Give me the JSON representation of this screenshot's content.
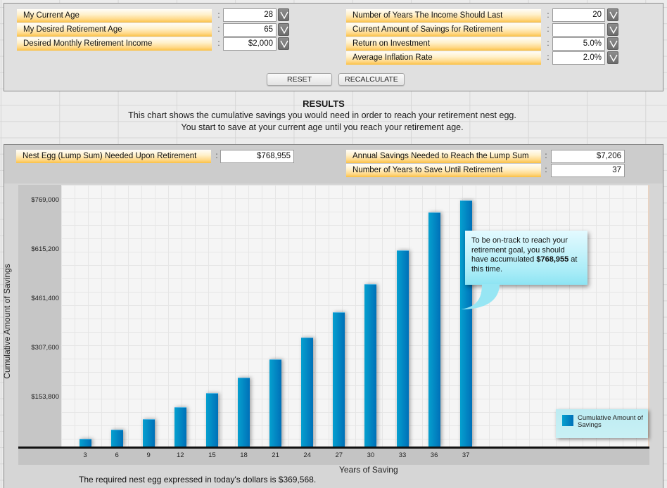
{
  "inputs": {
    "left": [
      {
        "label": "My Current Age",
        "value": "28"
      },
      {
        "label": "My Desired Retirement Age",
        "value": "65"
      },
      {
        "label": "Desired Monthly Retirement Income",
        "value": "$2,000"
      }
    ],
    "right": [
      {
        "label": "Number of Years The Income Should Last",
        "value": "20"
      },
      {
        "label": "Current Amount of Savings for Retirement",
        "value": ""
      },
      {
        "label": "Return on Investment",
        "value": "5.0%"
      },
      {
        "label": "Average Inflation Rate",
        "value": "2.0%"
      }
    ],
    "separator": ":",
    "dropdown_icon": "chevron-down-icon",
    "reset_label": "RESET",
    "recalculate_label": "RECALCULATE"
  },
  "results": {
    "title": "RESULTS",
    "description_line1": "This chart shows the cumulative savings you would need in order to reach your retirement nest egg.",
    "description_line2": "You start to save at your current age until you reach your retirement age.",
    "nest_egg": {
      "label": "Nest Egg (Lump Sum) Needed Upon Retirement",
      "value": "$768,955"
    },
    "annual_savings": {
      "label": "Annual Savings Needed to Reach the Lump Sum",
      "value": "$7,206"
    },
    "years_to_save": {
      "label": "Number of Years to Save Until Retirement",
      "value": "37"
    },
    "callout": {
      "text_before": "To be on-track to reach your retirement goal, you should have accumulated ",
      "amount": "$768,955",
      "text_after": " at this time."
    },
    "footnote": "The required nest egg expressed in today's dollars is $369,568."
  },
  "chart_data": {
    "type": "bar",
    "title": "",
    "xlabel": "Years of Saving",
    "ylabel": "Cumulative Amount of Savings",
    "categories": [
      "3",
      "6",
      "9",
      "12",
      "15",
      "18",
      "21",
      "24",
      "27",
      "30",
      "33",
      "36",
      "37"
    ],
    "series": [
      {
        "name": "Cumulative Amount of Savings",
        "values": [
          25000,
          53000,
          86000,
          122000,
          166000,
          215000,
          273000,
          341000,
          419000,
          507000,
          612000,
          732000,
          768955
        ]
      }
    ],
    "yticks": [
      153800,
      307600,
      461400,
      615200,
      769000
    ],
    "ytick_labels": [
      "$153,800",
      "$307,600",
      "$461,400",
      "$615,200",
      "$769,000"
    ],
    "ylim": [
      0,
      769000
    ],
    "grid": true,
    "legend": {
      "position": "bottom-right",
      "entries": [
        "Cumulative Amount of Savings"
      ]
    },
    "colors": {
      "bar": "#0a8ac6",
      "bar_light": "#05a0cf",
      "bar_dark": "#0070b8"
    }
  }
}
